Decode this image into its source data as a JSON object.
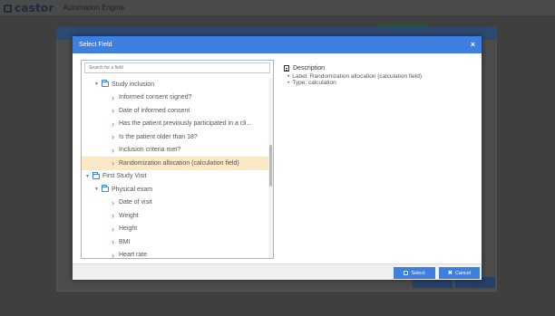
{
  "app": {
    "brand": "castor",
    "subtitle": "Automation Engine"
  },
  "modal": {
    "title": "Select Field",
    "close_glyph": "×",
    "search": {
      "placeholder": "Search for a field",
      "value": ""
    },
    "tree": [
      {
        "label": "Study inclusion",
        "kind": "folder",
        "level": 1,
        "expanded": true
      },
      {
        "label": "Informed consent signed?",
        "kind": "field",
        "level": 2
      },
      {
        "label": "Date of informed consent",
        "kind": "field",
        "level": 2
      },
      {
        "label": "Has the patient previously participated in a cli...",
        "kind": "field",
        "level": 2
      },
      {
        "label": "Is the patient older than 18?",
        "kind": "field",
        "level": 2
      },
      {
        "label": "Inclusion criteria met?",
        "kind": "field",
        "level": 2
      },
      {
        "label": "Randomization allocation (calculation field)",
        "kind": "field",
        "level": 2,
        "selected": true
      },
      {
        "label": "First Study Visit",
        "kind": "folder",
        "level": 0,
        "expanded": true
      },
      {
        "label": "Physical exam",
        "kind": "folder",
        "level": 1,
        "expanded": true
      },
      {
        "label": "Date of visit",
        "kind": "field",
        "level": 2
      },
      {
        "label": "Weight",
        "kind": "field",
        "level": 2
      },
      {
        "label": "Height",
        "kind": "field",
        "level": 2
      },
      {
        "label": "BMI",
        "kind": "field",
        "level": 2
      },
      {
        "label": "Heart rate",
        "kind": "field",
        "level": 2
      }
    ],
    "description": {
      "heading": "Description",
      "items": [
        "Label: Randomization allocation (calculation field)",
        "Type: calculation"
      ]
    },
    "footer": {
      "select_label": "Select",
      "cancel_label": "Cancel"
    }
  },
  "colors": {
    "accent": "#3f7fe0",
    "selected_row": "#fbe9c6"
  },
  "icons": {
    "field": "chevron-right-icon",
    "folder": "folder-open-icon",
    "expand": "caret-down-icon"
  }
}
